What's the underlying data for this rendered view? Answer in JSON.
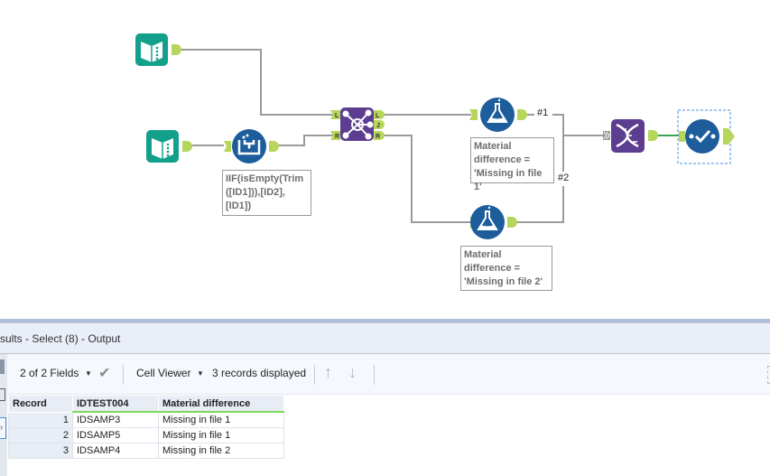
{
  "workflow": {
    "tools": [
      {
        "id": "input-1",
        "type": "input-data",
        "icon": "book-icon"
      },
      {
        "id": "input-2",
        "type": "input-data",
        "icon": "book-icon"
      },
      {
        "id": "formula",
        "type": "formula",
        "icon": "formula-beaker-icon"
      },
      {
        "id": "join",
        "type": "join",
        "icon": "join-icon",
        "anchors_in": [
          "L",
          "R"
        ],
        "anchors_out": [
          "L",
          "J",
          "R"
        ]
      },
      {
        "id": "formula-1",
        "type": "formula",
        "icon": "flask-icon"
      },
      {
        "id": "formula-2",
        "type": "formula",
        "icon": "flask-icon"
      },
      {
        "id": "union",
        "type": "union",
        "icon": "dna-icon"
      },
      {
        "id": "select",
        "type": "select",
        "icon": "select-check-icon",
        "selected": true
      }
    ],
    "annotations": {
      "formula": "IIF(isEmpty(Trim\n([ID1])),[ID2],\n[ID1])",
      "formula_1": "Material\ndifference =\n'Missing in file 1'",
      "formula_2": "Material\ndifference =\n'Missing in file 2'"
    },
    "connection_labels": {
      "c1": "#1",
      "c2": "#2"
    },
    "anchor_labels": {
      "L": "L",
      "R": "R",
      "J": "J"
    },
    "colors": {
      "teal": "#12a08a",
      "blue": "#1d5d9b",
      "purple": "#5c3d8f",
      "anchor": "#b5d65a",
      "line": "#9b9b9b",
      "active_line": "#3aa655"
    }
  },
  "results": {
    "title": "sults - Select (8) - Output",
    "toolbar": {
      "fields": "2 of 2 Fields",
      "cell_viewer": "Cell Viewer",
      "records": "3 records displayed"
    },
    "columns": [
      "Record",
      "IDTEST004",
      "Material difference"
    ],
    "rows": [
      {
        "record": "1",
        "id": "IDSAMP3",
        "diff": "Missing in file 1"
      },
      {
        "record": "2",
        "id": "IDSAMP5",
        "diff": "Missing in file 1"
      },
      {
        "record": "3",
        "id": "IDSAMP4",
        "diff": "Missing in file 2"
      }
    ]
  }
}
